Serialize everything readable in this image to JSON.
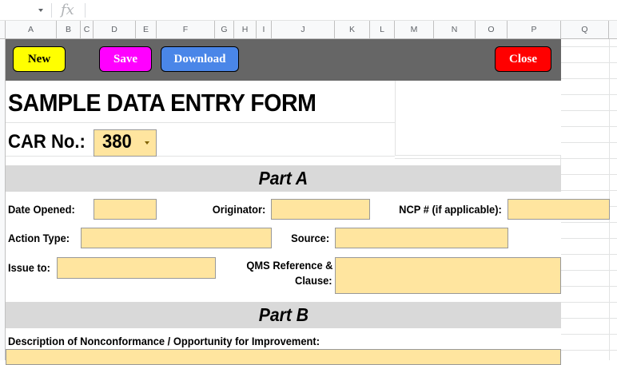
{
  "formula_bar": {
    "fx_label": "fx"
  },
  "columns": [
    "A",
    "B",
    "C",
    "D",
    "E",
    "F",
    "G",
    "H",
    "I",
    "J",
    "K",
    "L",
    "M",
    "N",
    "O",
    "P",
    "Q"
  ],
  "toolbar": {
    "new_label": "New",
    "save_label": "Save",
    "download_label": "Download",
    "close_label": "Close"
  },
  "form": {
    "title": "SAMPLE DATA ENTRY FORM",
    "car_label": "CAR No.:",
    "car_value": "380",
    "part_a": "Part A",
    "part_b": "Part B",
    "fields": {
      "date_opened": "Date Opened:",
      "originator": "Originator:",
      "ncp": "NCP # (if applicable):",
      "action_type": "Action Type:",
      "source": "Source:",
      "issue_to": "Issue to:",
      "qms_line1": "QMS Reference &",
      "qms_line2": "Clause:",
      "description": "Description of Nonconformance / Opportunity for Improvement:"
    }
  },
  "colors": {
    "input_fill": "#ffe59f",
    "toolbar_bg": "#666666",
    "section_bg": "#d9d9d9",
    "new_btn": "#ffff00",
    "save_btn": "#ff00ff",
    "download_btn": "#4a86e8",
    "close_btn": "#ff0000"
  }
}
